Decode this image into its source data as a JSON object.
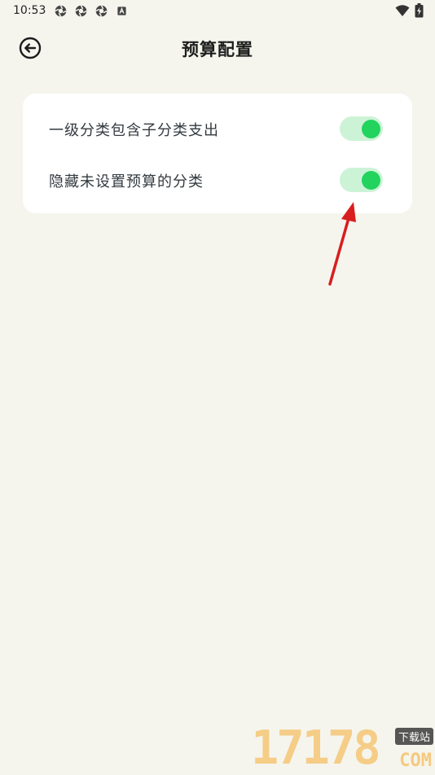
{
  "status_bar": {
    "time": "10:53",
    "left_icons": [
      "aperture-icon",
      "aperture-icon",
      "aperture-icon",
      "a-badge-icon"
    ],
    "right_icons": [
      "wifi-icon",
      "battery-charging-icon"
    ]
  },
  "header": {
    "back_icon": "back-arrow-circle-icon",
    "title": "预算配置"
  },
  "settings": [
    {
      "label": "一级分类包含子分类支出",
      "enabled": true
    },
    {
      "label": "隐藏未设置预算的分类",
      "enabled": true
    }
  ],
  "colors": {
    "background": "#f5f5ee",
    "card": "#ffffff",
    "toggle_track_on": "#cdf3d7",
    "toggle_knob_on": "#22d35e",
    "annotation_arrow": "#d81e1e"
  },
  "watermark": {
    "number": "17178",
    "tag": "下载站",
    "domain": "COM"
  }
}
